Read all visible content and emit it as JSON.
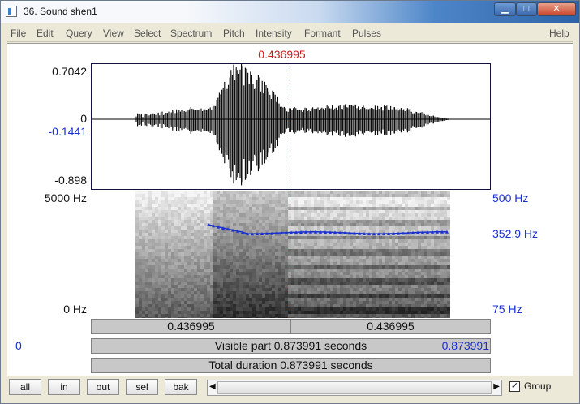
{
  "window": {
    "title": "36. Sound shen1"
  },
  "menu": [
    "File",
    "Edit",
    "Query",
    "View",
    "Select",
    "Spectrum",
    "Pitch",
    "Intensity",
    "Formant",
    "Pulses",
    "Help"
  ],
  "cursor": {
    "time": "0.436995"
  },
  "waveform": {
    "max_label": "0.7042",
    "zero_label": "0",
    "value_label": "-0.1441",
    "min_label": "-0.898"
  },
  "spectrogram": {
    "top_label": "5000 Hz",
    "bottom_label": "0 Hz"
  },
  "pitch": {
    "top_label": "500 Hz",
    "current_label": "352.9 Hz",
    "bottom_label": "75 Hz"
  },
  "time_bar": {
    "left_segment": "0.436995",
    "right_segment": "0.436995",
    "visible_start": "0",
    "visible_text": "Visible part 0.873991 seconds",
    "visible_end": "0.873991",
    "total_text": "Total duration 0.873991 seconds"
  },
  "controls": {
    "all": "all",
    "in": "in",
    "out": "out",
    "sel": "sel",
    "bak": "bak",
    "group": "Group",
    "group_checked": "✓"
  },
  "colors": {
    "cursor": "#d11a1a",
    "pitch": "#1a2fd0"
  }
}
